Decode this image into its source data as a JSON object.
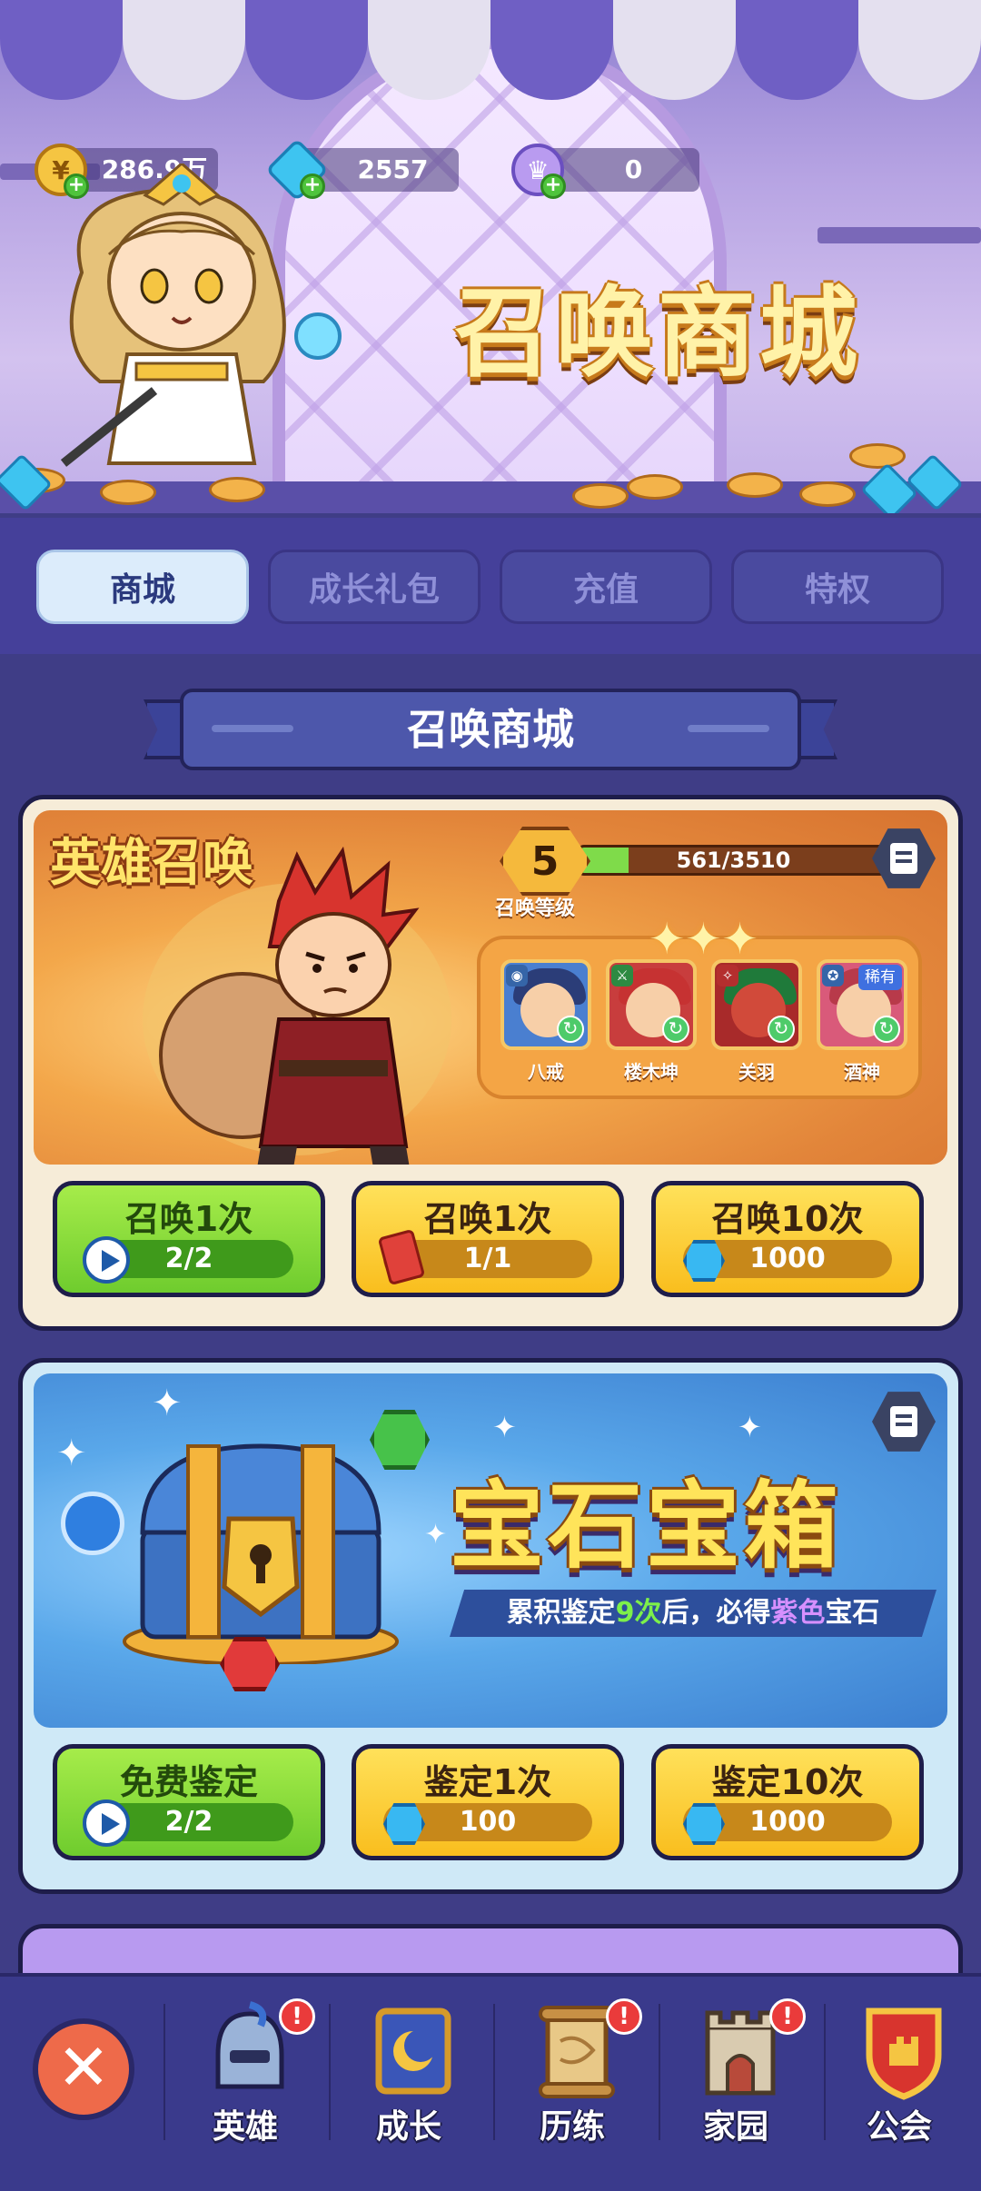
{
  "currencies": [
    {
      "icon": "gold-coin-icon",
      "value": "286.9万"
    },
    {
      "icon": "diamond-icon",
      "value": "2557"
    },
    {
      "icon": "crown-token-icon",
      "value": "0"
    }
  ],
  "banner": {
    "title": "召唤商城"
  },
  "tabs": [
    {
      "label": "商城",
      "active": true
    },
    {
      "label": "成长礼包",
      "active": false
    },
    {
      "label": "充值",
      "active": false
    },
    {
      "label": "特权",
      "active": false
    }
  ],
  "section": {
    "title": "召唤商城"
  },
  "hero_summon": {
    "title": "英雄召唤",
    "level": "5",
    "level_label": "召唤等级",
    "xp": "561/3510",
    "xp_fraction": 0.16,
    "heroes": [
      {
        "name": "八戒",
        "rare": ""
      },
      {
        "name": "楼木坤",
        "rare": ""
      },
      {
        "name": "关羽",
        "rare": ""
      },
      {
        "name": "酒神",
        "rare": "稀有"
      }
    ],
    "buttons": [
      {
        "label": "召唤1次",
        "cost_icon": "ad-play-icon",
        "cost": "2/2",
        "color": "green"
      },
      {
        "label": "召唤1次",
        "cost_icon": "summon-ticket-icon",
        "cost": "1/1",
        "color": "yellow"
      },
      {
        "label": "召唤10次",
        "cost_icon": "diamond-icon",
        "cost": "1000",
        "color": "yellow"
      }
    ]
  },
  "gem_chest": {
    "title": "宝石宝箱",
    "subtitle_pre": "累积鉴定",
    "subtitle_count": "9次",
    "subtitle_mid": "后，必得",
    "subtitle_color": "紫色",
    "subtitle_post": "宝石",
    "buttons": [
      {
        "label": "免费鉴定",
        "cost_icon": "ad-play-icon",
        "cost": "2/2",
        "color": "green"
      },
      {
        "label": "鉴定1次",
        "cost_icon": "diamond-icon",
        "cost": "100",
        "color": "yellow"
      },
      {
        "label": "鉴定10次",
        "cost_icon": "diamond-icon",
        "cost": "1000",
        "color": "yellow"
      }
    ]
  },
  "bottom_nav": [
    {
      "label": "英雄",
      "badge": "!"
    },
    {
      "label": "成长",
      "badge": ""
    },
    {
      "label": "历练",
      "badge": "!"
    },
    {
      "label": "家园",
      "badge": "!"
    },
    {
      "label": "公会",
      "badge": ""
    }
  ]
}
